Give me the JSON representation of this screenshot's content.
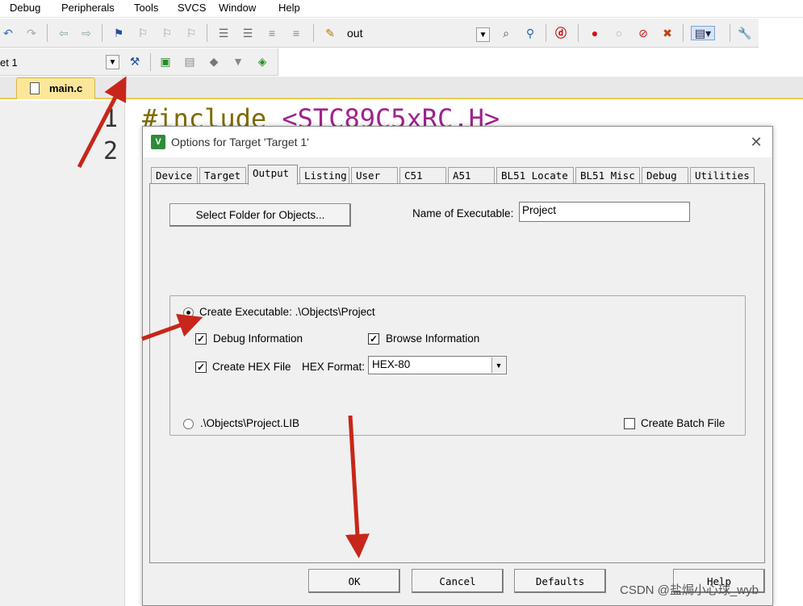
{
  "menubar": {
    "items": [
      "Debug",
      "Peripherals",
      "Tools",
      "SVCS",
      "Window",
      "Help"
    ]
  },
  "toolbar": {
    "output_name": "out",
    "target_name": "et 1"
  },
  "editor": {
    "tab_label": "main.c",
    "line_numbers": [
      "1",
      "2"
    ],
    "code_keyword": "#include",
    "code_header": "<STC89C5xRC.H>"
  },
  "dialog": {
    "title": "Options for Target 'Target 1'",
    "close_symbol": "✕",
    "tabs": [
      "Device",
      "Target",
      "Output",
      "Listing",
      "User",
      "C51",
      "A51",
      "BL51 Locate",
      "BL51 Misc",
      "Debug",
      "Utilities"
    ],
    "active_tab": "Output",
    "select_folder_label": "Select Folder for Objects...",
    "name_exe_label": "Name of Executable:",
    "name_exe_value": "Project",
    "create_exe_label": "Create Executable:  .\\Objects\\Project",
    "debug_info_label": "Debug Information",
    "browse_info_label": "Browse Information",
    "create_hex_label": "Create HEX File",
    "hex_format_label": "HEX Format:",
    "hex_format_value": "HEX-80",
    "create_lib_label": ".\\Objects\\Project.LIB",
    "batch_file_label": "Create Batch File",
    "check_symbol": "✓",
    "buttons": {
      "ok": "OK",
      "cancel": "Cancel",
      "defaults": "Defaults",
      "help": "Help"
    }
  },
  "state": {
    "create_executable_selected": true,
    "debug_information": true,
    "browse_information": true,
    "create_hex_file": true,
    "create_batch_file": false
  },
  "watermark": "CSDN @盐焗小心球_wyb",
  "colors": {
    "annotation_arrow": "#c8261a",
    "tab_highlight": "#fbe69a",
    "code_keyword": "#7f6a00",
    "code_header": "#a0228a"
  }
}
